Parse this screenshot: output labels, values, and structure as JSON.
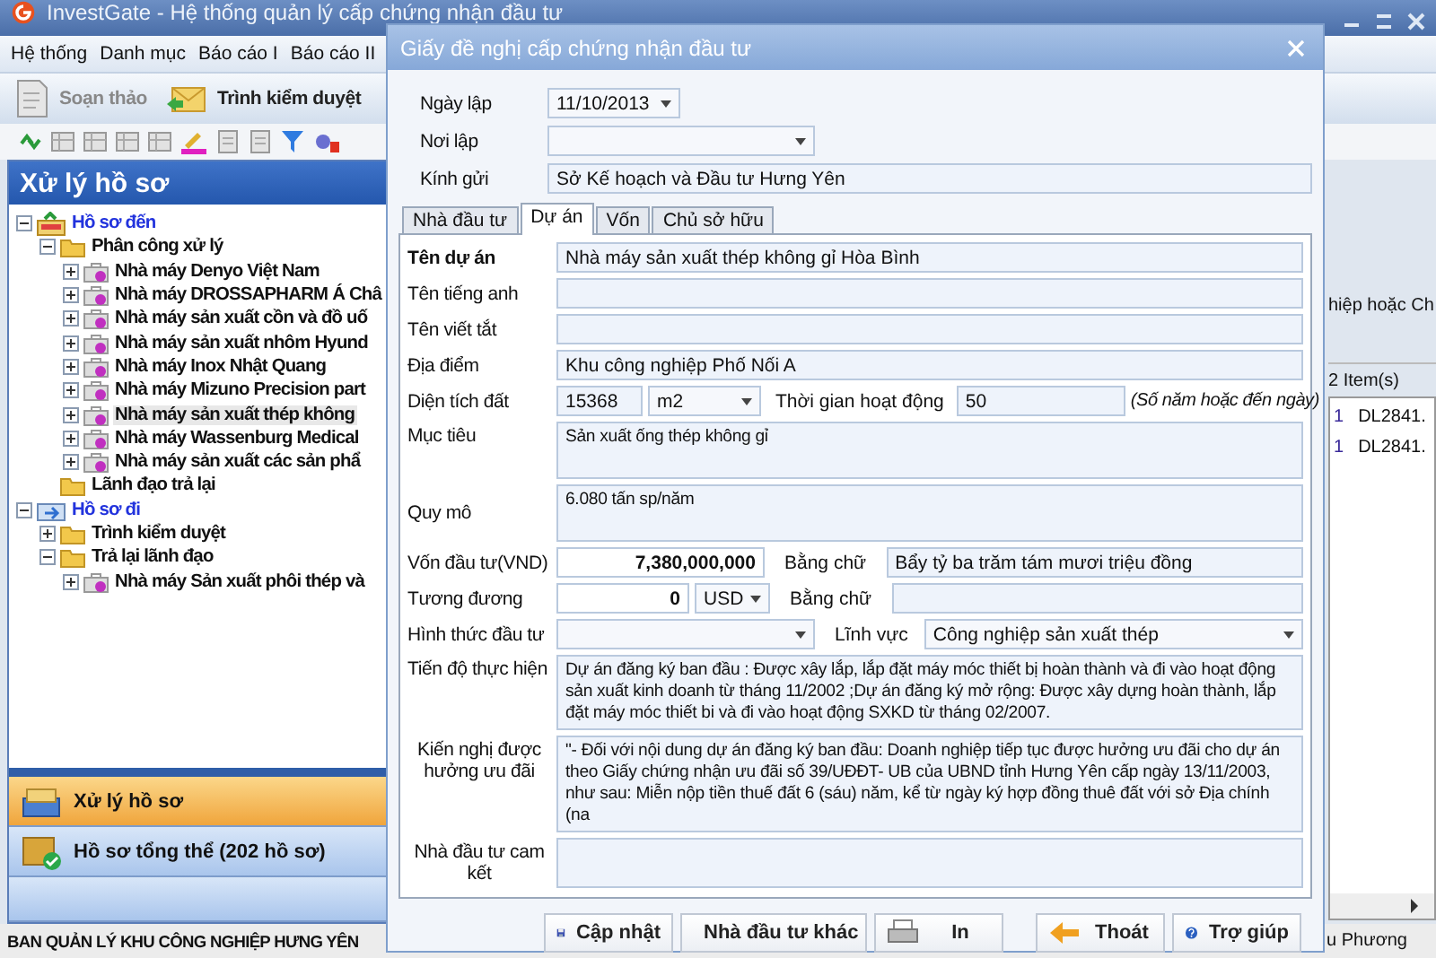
{
  "window": {
    "title": "InvestGate - Hệ thống quản lý cấp chứng nhận đầu tư"
  },
  "menu": [
    "Hệ thống",
    "Danh mục",
    "Báo cáo I",
    "Báo cáo II"
  ],
  "toolbar": [
    {
      "label": "Soạn thảo",
      "disabled": true
    },
    {
      "label": "Trình kiểm duyệt",
      "disabled": false
    }
  ],
  "panel": {
    "title": "Xử lý hồ sơ",
    "tree": [
      {
        "label": "Hồ sơ đến",
        "kind": "inbox",
        "expanded": true,
        "selected": false,
        "children": [
          {
            "label": "Phân công xử lý",
            "kind": "folder",
            "expanded": true,
            "selected": false,
            "children": [
              {
                "label": "Nhà máy Denyo Việt Nam",
                "kind": "project",
                "expanded": false,
                "selected": false
              },
              {
                "label": "Nhà máy DROSSAPHARM Á Châ",
                "kind": "project",
                "expanded": false,
                "selected": false
              },
              {
                "label": "Nhà máy sản xuất cồn và đồ uố",
                "kind": "project",
                "expanded": false,
                "selected": false
              },
              {
                "label": "Nhà máy sản xuất nhôm Hyund",
                "kind": "project",
                "expanded": false,
                "selected": false
              },
              {
                "label": "Nhà máy Inox Nhật Quang",
                "kind": "project",
                "expanded": false,
                "selected": false
              },
              {
                "label": "Nhà máy Mizuno Precision part",
                "kind": "project",
                "expanded": false,
                "selected": false
              },
              {
                "label": "Nhà máy sản xuất thép không",
                "kind": "project",
                "expanded": false,
                "selected": true
              },
              {
                "label": "Nhà máy Wassenburg Medical",
                "kind": "project",
                "expanded": false,
                "selected": false
              },
              {
                "label": "Nhà máy sản xuất các sản phẩ",
                "kind": "project",
                "expanded": false,
                "selected": false
              }
            ]
          },
          {
            "label": "Lãnh đạo trả lại",
            "kind": "folder",
            "selected": false
          }
        ]
      },
      {
        "label": "Hồ sơ đi",
        "kind": "outbox",
        "expanded": true,
        "selected": false,
        "children": [
          {
            "label": "Trình kiểm duyệt",
            "kind": "folder",
            "expanded": false,
            "selected": false
          },
          {
            "label": "Trả lại lãnh đạo",
            "kind": "folder",
            "expanded": true,
            "selected": false,
            "children": [
              {
                "label": "Nhà máy Sản xuất phôi thép và",
                "kind": "project",
                "expanded": false,
                "selected": false
              }
            ]
          }
        ]
      }
    ]
  },
  "nav": [
    {
      "label": "Xử lý hồ sơ",
      "selected": true
    },
    {
      "label": "Hồ sơ tổng thể (202 hồ sơ)",
      "selected": false
    }
  ],
  "background_list": {
    "caption": "hiệp hoặc Ch",
    "count": "2 Item(s)",
    "rows": [
      {
        "column_1": "1",
        "column_2": "DL2841."
      },
      {
        "column_1": "1",
        "column_2": "DL2841."
      }
    ]
  },
  "status_bar": {
    "left": "BAN QUẢN LÝ KHU CÔNG NGHIỆP HƯNG YÊN",
    "right": "u Phương"
  },
  "dialog": {
    "title": "Giấy đề nghị cấp chứng nhận đầu tư",
    "header_fields": [
      {
        "label": "Ngày lập",
        "kind": "date",
        "value": "11/10/2013"
      },
      {
        "label": "Nơi lập",
        "kind": "select"
      },
      {
        "label": "Kính gửi",
        "kind": "text",
        "value": "Sở Kế hoạch và Đầu tư Hưng Yên"
      }
    ],
    "tabs": [
      {
        "label": "Nhà đầu tư",
        "selected": false
      },
      {
        "label": "Dự án",
        "selected": true
      },
      {
        "label": "Vốn",
        "selected": false
      },
      {
        "label": "Chủ sở hữu",
        "selected": false
      }
    ],
    "project": {
      "name": {
        "label": "Tên dự án",
        "value": "Nhà máy sản xuất thép không gỉ Hòa Bình"
      },
      "english_name": {
        "label": "Tên tiếng anh"
      },
      "short_name": {
        "label": "Tên viết tắt"
      },
      "location": {
        "label": "Địa điểm",
        "value": "Khu công nghiệp Phố Nối A"
      },
      "area": {
        "label": "Diện tích đất",
        "value": "15368",
        "unit": "m2",
        "duration_label": "Thời gian hoạt động",
        "duration": "50",
        "duration_hint": "(Số năm hoặc đến ngày)"
      },
      "objective": {
        "label": "Mục tiêu",
        "value": "Sản xuất ống thép không gỉ"
      },
      "scale": {
        "label": "Quy mô",
        "value": "6.080 tấn sp/năm"
      },
      "capital": {
        "label": "Vốn đầu tư(VND)",
        "value": "7,380,000,000",
        "words_label": "Bằng chữ",
        "words": "Bẩy tỷ ba trăm tám mươi triệu đồng"
      },
      "equivalent": {
        "label": "Tương đương",
        "value": "0",
        "currency": "USD",
        "words_label": "Bằng chữ"
      },
      "investment_form": {
        "label": "Hình thức đầu tư",
        "sector_label": "Lĩnh vực",
        "sector": "Công nghiệp sản xuất thép"
      },
      "schedule": {
        "label": "Tiến độ thực hiện",
        "value": "Dự án đăng ký ban đầu : Được xây lắp, lắp đặt máy móc thiết bị hoàn thành và đi vào hoạt động sản xuất kinh doanh từ tháng 11/2002 ;Dự án đăng ký mở rộng: Được xây dựng hoàn thành, lắp đặt máy móc thiết bi và đi vào hoạt động SXKD từ tháng 02/2007."
      },
      "incentives": {
        "label": "Kiến nghị được hưởng ưu đãi",
        "value": "\"- Đối với nội dung dự án đăng ký ban đầu: Doanh nghiệp tiếp tục được hưởng ưu đãi cho dự án theo Giấy chứng nhận ưu đãi số 39/UĐĐT- UB của UBND tỉnh Hưng Yên cấp ngày 13/11/2003, như sau: Miễn nộp tiền thuế đất 6 (sáu) năm, kể từ ngày ký hợp đồng thuê đất với sở Địa chính (na"
      },
      "commitment": {
        "label": "Nhà đầu tư cam kết"
      }
    },
    "buttons": [
      "Cập nhật",
      "Nhà đầu tư khác",
      "In",
      "Thoát",
      "Trợ giúp"
    ]
  }
}
